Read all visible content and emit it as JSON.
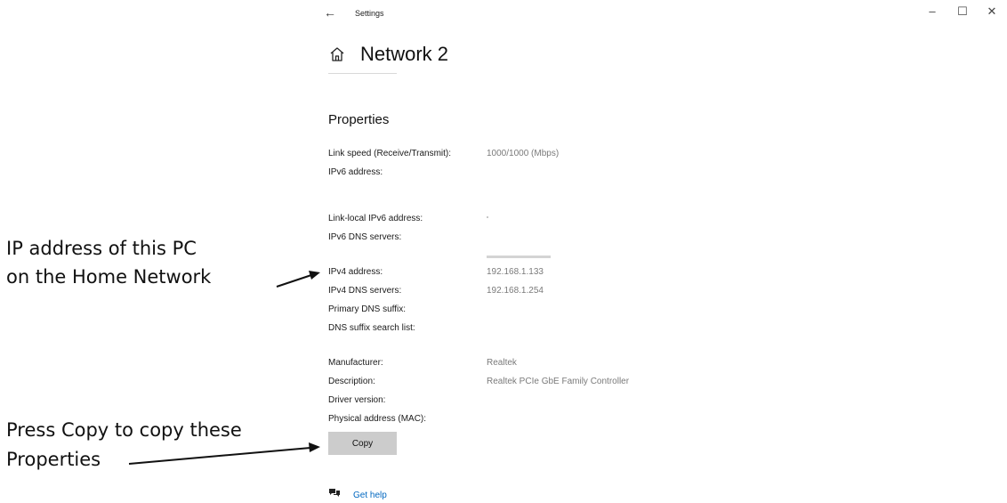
{
  "window": {
    "back_glyph": "←",
    "title": "Settings",
    "minimize_glyph": "–",
    "maximize_glyph": "☐",
    "close_glyph": "✕"
  },
  "page": {
    "title": "Network 2",
    "home_icon": "home-icon"
  },
  "properties": {
    "heading": "Properties",
    "rows": [
      {
        "label": "Link speed (Receive/Transmit):",
        "value": "1000/1000 (Mbps)"
      },
      {
        "label": "IPv6 address:",
        "value": ""
      },
      {
        "label": "Link-local IPv6 address:",
        "value": ""
      },
      {
        "label": "IPv6 DNS servers:",
        "value": ""
      },
      {
        "label": "IPv4 address:",
        "value": "192.168.1.133"
      },
      {
        "label": "IPv4 DNS servers:",
        "value": "192.168.1.254"
      },
      {
        "label": "Primary DNS suffix:",
        "value": ""
      },
      {
        "label": "DNS suffix search list:",
        "value": ""
      },
      {
        "label": "Manufacturer:",
        "value": "Realtek"
      },
      {
        "label": "Description:",
        "value": "Realtek PCIe GbE Family Controller"
      },
      {
        "label": "Driver version:",
        "value": ""
      },
      {
        "label": "Physical address (MAC):",
        "value": ""
      }
    ],
    "copy_label": "Copy"
  },
  "help": {
    "icon": "chat-help-icon",
    "label": "Get help"
  },
  "annotations": {
    "ip_line1": "IP address of this PC",
    "ip_line2": "on the Home Network",
    "copy_line1": "Press Copy to copy these",
    "copy_line2": "Properties"
  }
}
